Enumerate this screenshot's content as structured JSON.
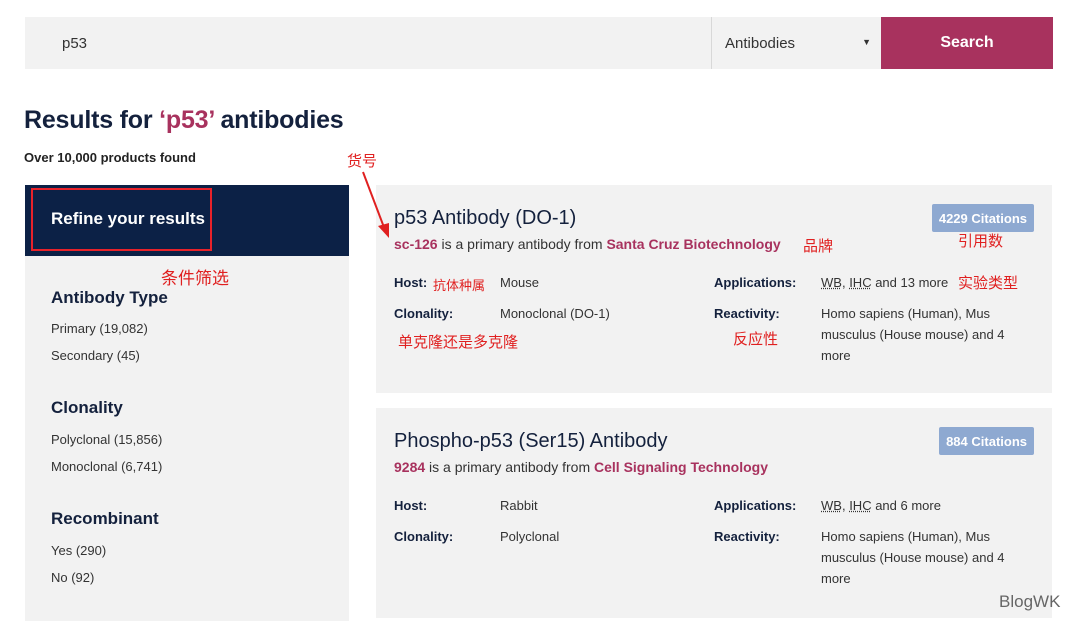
{
  "search": {
    "query": "p53",
    "category": "Antibodies",
    "button_label": "Search"
  },
  "results": {
    "title_prefix": "Results for ",
    "title_query": "‘p53’",
    "title_suffix": " antibodies",
    "count": "Over 10,000 products found"
  },
  "sidebar": {
    "header": "Refine your results",
    "facets": [
      {
        "title": "Antibody Type",
        "items": [
          "Primary (19,082)",
          "Secondary (45)"
        ]
      },
      {
        "title": "Clonality",
        "items": [
          "Polyclonal (15,856)",
          "Monoclonal (6,741)"
        ]
      },
      {
        "title": "Recombinant",
        "items": [
          "Yes (290)",
          "No (92)"
        ]
      }
    ]
  },
  "products": [
    {
      "title": "p53 Antibody (DO-1)",
      "catalog": "sc-126",
      "middle": " is a primary antibody from ",
      "brand": "Santa Cruz Biotechnology",
      "citations": "4229 Citations",
      "host_label": "Host:",
      "host": "Mouse",
      "clonality_label": "Clonality:",
      "clonality": "Monoclonal (DO-1)",
      "applications_label": "Applications:",
      "app_wb": "WB",
      "app_sep": ", ",
      "app_ihc": "IHC",
      "app_more": " and 13 more",
      "reactivity_label": "Reactivity:",
      "reactivity": "Homo sapiens (Human), Mus musculus (House mouse) and 4 more"
    },
    {
      "title": "Phospho-p53 (Ser15) Antibody",
      "catalog": "9284",
      "middle": " is a primary antibody from ",
      "brand": "Cell Signaling Technology",
      "citations": "884 Citations",
      "host_label": "Host:",
      "host": "Rabbit",
      "clonality_label": "Clonality:",
      "clonality": "Polyclonal",
      "applications_label": "Applications:",
      "app_wb": "WB",
      "app_sep": ", ",
      "app_ihc": "IHC",
      "app_more": " and 6 more",
      "reactivity_label": "Reactivity:",
      "reactivity": "Homo sapiens (Human), Mus musculus (House mouse) and 4 more"
    }
  ],
  "annotations": {
    "catalog_no": "货号",
    "filter": "条件筛选",
    "brand": "品牌",
    "citations": "引用数",
    "host_species": "抗体种属",
    "experiment_type": "实验类型",
    "mono_poly": "单克隆还是多克隆",
    "reactivity": "反应性",
    "color": "#e02020"
  },
  "watermark": "BlogWK",
  "colors": {
    "accent": "#a8325e",
    "navy": "#0c2146",
    "badge": "#8ea9d1",
    "panel": "#f2f2f2"
  }
}
